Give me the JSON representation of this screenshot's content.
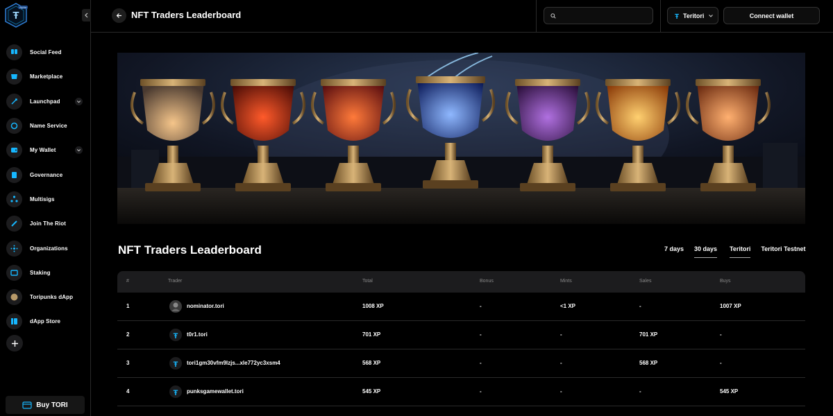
{
  "app": {
    "logo_badge": "Alpha"
  },
  "sidebar": {
    "items": [
      {
        "label": "Social Feed",
        "icon": "feed-icon",
        "has_chevron": false
      },
      {
        "label": "Marketplace",
        "icon": "marketplace-icon",
        "has_chevron": false
      },
      {
        "label": "Launchpad",
        "icon": "rocket-icon",
        "has_chevron": true
      },
      {
        "label": "Name Service",
        "icon": "name-service-icon",
        "has_chevron": false
      },
      {
        "label": "My Wallet",
        "icon": "wallet-icon",
        "has_chevron": true
      },
      {
        "label": "Governance",
        "icon": "governance-icon",
        "has_chevron": false
      },
      {
        "label": "Multisigs",
        "icon": "multisig-icon",
        "has_chevron": false
      },
      {
        "label": "Join The Riot",
        "icon": "riot-icon",
        "has_chevron": false
      },
      {
        "label": "Organizations",
        "icon": "organizations-icon",
        "has_chevron": false
      },
      {
        "label": "Staking",
        "icon": "staking-icon",
        "has_chevron": false
      },
      {
        "label": "Toripunks dApp",
        "icon": "toripunks-icon",
        "has_chevron": false
      },
      {
        "label": "dApp Store",
        "icon": "dapp-store-icon",
        "has_chevron": false
      }
    ],
    "buy_label": "Buy TORI"
  },
  "header": {
    "title": "NFT Traders Leaderboard",
    "search_placeholder": "",
    "network": "Teritori",
    "connect_label": "Connect wallet"
  },
  "leaderboard": {
    "title": "NFT Traders Leaderboard",
    "period_tabs": [
      {
        "label": "7 days",
        "active": false
      },
      {
        "label": "30 days",
        "active": true
      }
    ],
    "network_tabs": [
      {
        "label": "Teritori",
        "active": true
      },
      {
        "label": "Teritori Testnet",
        "active": false
      }
    ],
    "columns": [
      "#",
      "Trader",
      "Total",
      "Bonus",
      "Mints",
      "Sales",
      "Buys"
    ],
    "rows": [
      {
        "rank": "1",
        "trader": "nominator.tori",
        "avatar": "photo",
        "total": "1008 XP",
        "bonus": "-",
        "mints": "<1 XP",
        "sales": "-",
        "buys": "1007 XP"
      },
      {
        "rank": "2",
        "trader": "t0r1.tori",
        "avatar": "tori",
        "total": "701 XP",
        "bonus": "-",
        "mints": "-",
        "sales": "701 XP",
        "buys": "-"
      },
      {
        "rank": "3",
        "trader": "tori1gm30vfm9lzjs...xle772yc3xsm4",
        "avatar": "tori",
        "total": "568 XP",
        "bonus": "-",
        "mints": "-",
        "sales": "568 XP",
        "buys": "-"
      },
      {
        "rank": "4",
        "trader": "punksgamewallet.tori",
        "avatar": "tori",
        "total": "545 XP",
        "bonus": "-",
        "mints": "-",
        "sales": "-",
        "buys": "545 XP"
      }
    ]
  },
  "colors": {
    "bg": "#000000",
    "panel": "#1c1c1e",
    "accent": "#16b7ff",
    "border": "#2a2a2a"
  }
}
